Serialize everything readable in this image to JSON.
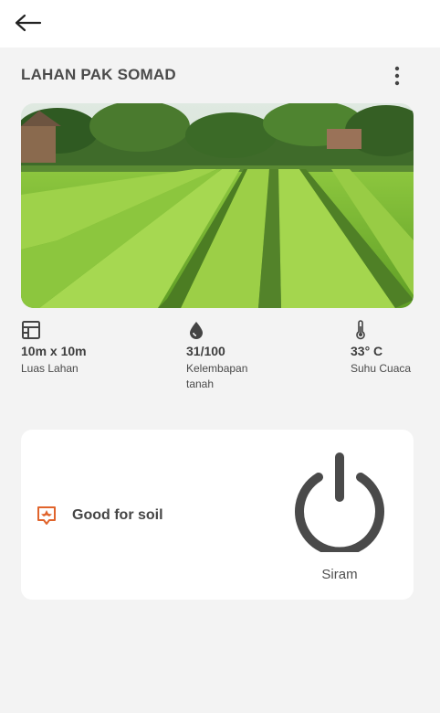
{
  "header": {
    "back_icon": "arrow-left-icon"
  },
  "field": {
    "title": "LAHAN PAK SOMAD",
    "menu_icon": "more-vertical-icon",
    "photo_alt": "Lahan tanaman hijau"
  },
  "stats": [
    {
      "icon": "area-grid-icon",
      "value": "10m x 10m",
      "label": "Luas Lahan"
    },
    {
      "icon": "water-drop-icon",
      "value": "31/100",
      "label": "Kelembapan tanah"
    },
    {
      "icon": "thermometer-icon",
      "value": "33° C",
      "label": "Suhu Cuaca"
    }
  ],
  "status_card": {
    "soil_icon": "plant-badge-icon",
    "soil_text": "Good for soil",
    "power_icon": "power-icon",
    "power_label": "Siram"
  },
  "colors": {
    "background": "#f3f3f3",
    "card": "#ffffff",
    "accent": "#e0642c",
    "text": "#444444"
  }
}
